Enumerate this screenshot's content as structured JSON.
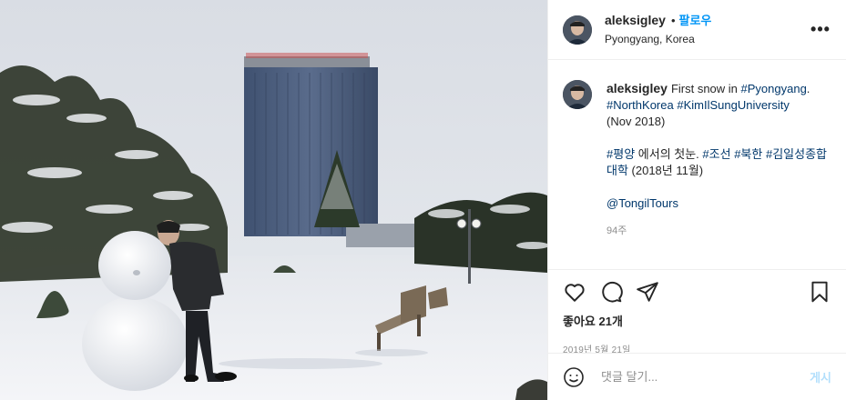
{
  "header": {
    "username": "aleksigley",
    "separator": "•",
    "follow_label": "팔로우",
    "location": "Pyongyang, Korea",
    "more_label": "•••"
  },
  "caption": {
    "username": "aleksigley",
    "text_1": "First snow in ",
    "tag_pyongyang": "#Pyongyang",
    "text_2": ".",
    "tag_northkorea": "#NorthKorea",
    "tag_kimilsung": "#KimIlSungUniversity",
    "text_3": "(Nov 2018)",
    "tag_ko_pyongyang": "#평양",
    "text_ko_1": " 에서의 첫눈. ",
    "tag_ko_joseon": "#조선",
    "tag_ko_bukhan": "#북한",
    "tag_ko_kimil": "#김일성종합대학",
    "text_ko_2": " (2018년 11월)",
    "mention": "@TongilTours",
    "time": "94주"
  },
  "actions": {
    "like_icon": "heart-icon",
    "comment_icon": "comment-icon",
    "share_icon": "share-icon",
    "save_icon": "bookmark-icon"
  },
  "likes_label": "좋아요 21개",
  "date_label": "2019년 5월 21일",
  "comment_box": {
    "emoji_icon": "smiley-icon",
    "placeholder": "댓글 달기...",
    "post_label": "게시"
  },
  "colors": {
    "link": "#00376b",
    "follow": "#0095f6",
    "post_disabled": "#b2dffc",
    "muted": "#8e8e8e"
  }
}
